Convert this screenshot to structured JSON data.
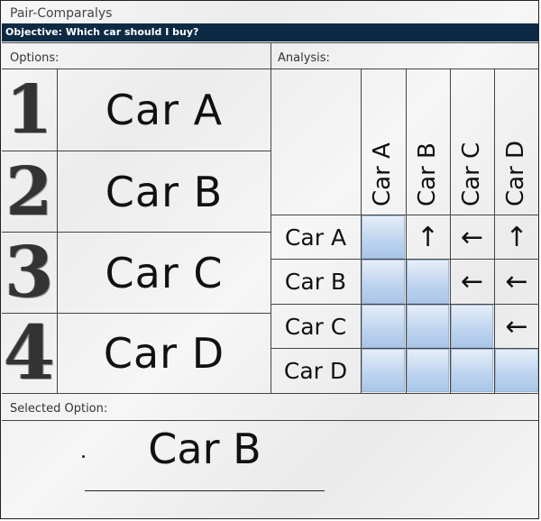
{
  "app_title": "Pair-Comparalys",
  "objective": "Objective: Which car should I buy?",
  "options_label": "Options:",
  "analysis_label": "Analysis:",
  "selected_label": "Selected Option:",
  "options": [
    {
      "number": "1",
      "name": "Car A"
    },
    {
      "number": "2",
      "name": "Car B"
    },
    {
      "number": "3",
      "name": "Car C"
    },
    {
      "number": "4",
      "name": "Car D"
    }
  ],
  "analysis": {
    "columns": [
      "Car A",
      "Car B",
      "Car C",
      "Car D"
    ],
    "rows": [
      "Car A",
      "Car B",
      "Car C",
      "Car D"
    ],
    "cells": [
      [
        "filled",
        "↑",
        "←",
        "↑"
      ],
      [
        "filled",
        "filled",
        "←",
        "←"
      ],
      [
        "filled",
        "filled",
        "filled",
        "←"
      ],
      [
        "filled",
        "filled",
        "filled",
        "filled"
      ]
    ],
    "fill_color": "#bcd3ee"
  },
  "selected_option": "Car B",
  "colors": {
    "objective_bar": "#0d2a44",
    "cell_fill": "#bcd3ee"
  }
}
